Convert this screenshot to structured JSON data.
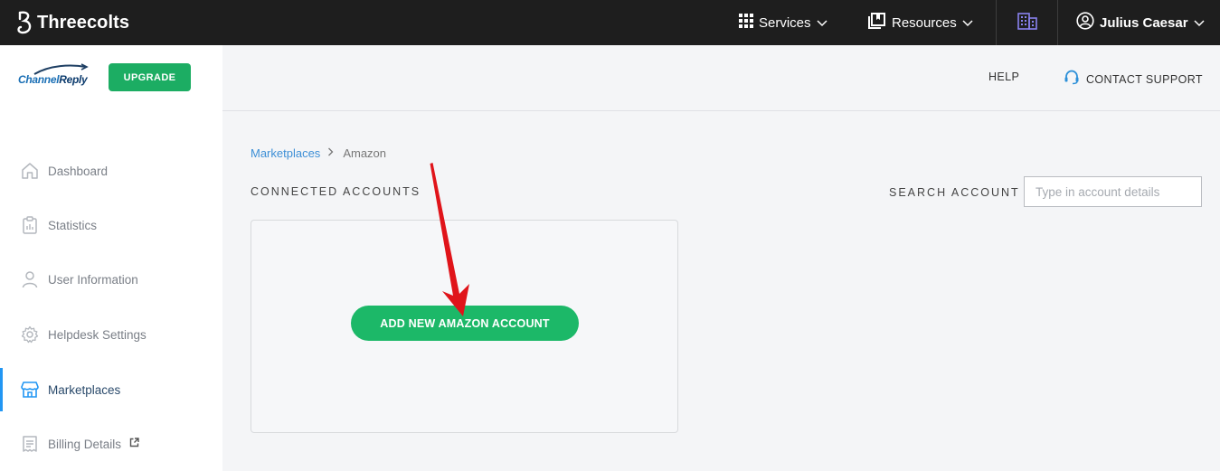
{
  "topbar": {
    "brand": "Threecolts",
    "services_label": "Services",
    "resources_label": "Resources",
    "user_name": "Julius Caesar",
    "icons": {
      "brand": "threecolts-logo-icon",
      "services": "grid-icon",
      "resources": "book-icon",
      "building": "building-icon",
      "user": "user-circle-icon",
      "chevron": "chevron-down-icon"
    }
  },
  "sidebar": {
    "logo_text_a": "Channel",
    "logo_text_b": "Reply",
    "upgrade_label": "UPGRADE",
    "items": [
      {
        "label": "Dashboard",
        "icon": "home-icon"
      },
      {
        "label": "Statistics",
        "icon": "clipboard-icon"
      },
      {
        "label": "User Information",
        "icon": "user-icon"
      },
      {
        "label": "Helpdesk Settings",
        "icon": "gear-icon"
      },
      {
        "label": "Marketplaces",
        "icon": "store-icon",
        "active": true
      },
      {
        "label": "Billing Details",
        "icon": "invoice-icon"
      }
    ]
  },
  "header": {
    "help_label": "HELP",
    "support_label": "CONTACT SUPPORT"
  },
  "breadcrumb": {
    "parent": "Marketplaces",
    "current": "Amazon"
  },
  "main": {
    "section_title": "CONNECTED ACCOUNTS",
    "search_label": "SEARCH ACCOUNT",
    "search_placeholder": "Type in account details",
    "add_button_label": "ADD NEW AMAZON ACCOUNT"
  },
  "colors": {
    "accent_green": "#1cb868",
    "topbar": "#1e1e1e",
    "active_blue": "#2196f3",
    "annotation_arrow": "#e0141a"
  }
}
